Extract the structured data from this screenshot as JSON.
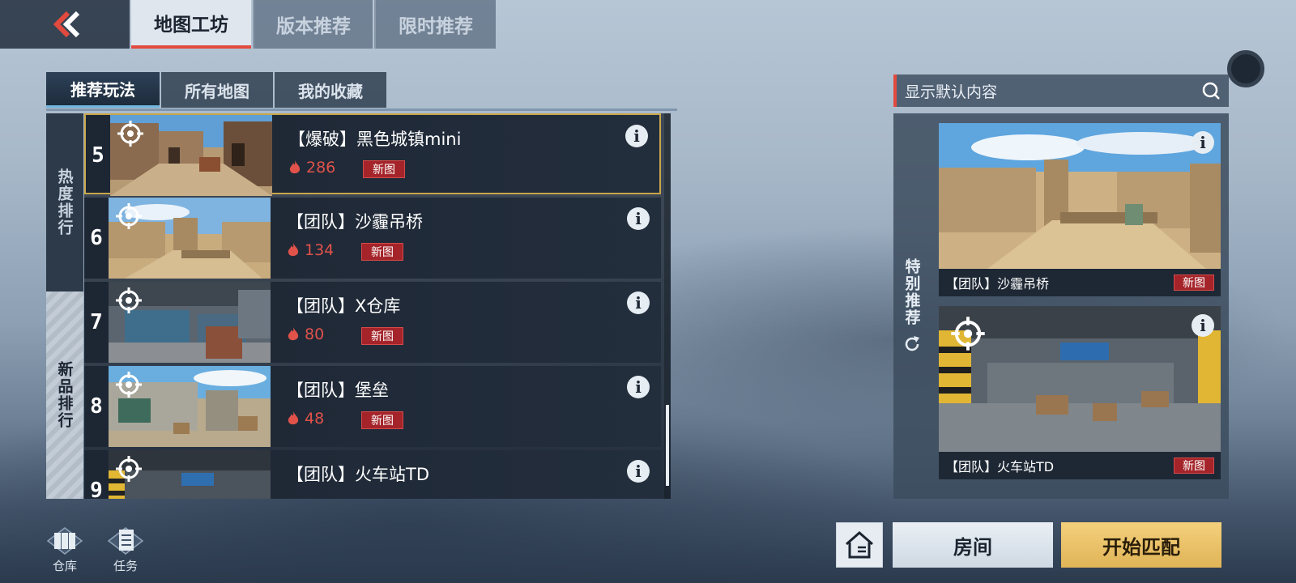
{
  "top_tabs": [
    {
      "label": "地图工坊",
      "active": true
    },
    {
      "label": "版本推荐",
      "active": false
    },
    {
      "label": "限时推荐",
      "active": false
    }
  ],
  "sub_tabs": [
    {
      "label": "推荐玩法",
      "active": true
    },
    {
      "label": "所有地图",
      "active": false
    },
    {
      "label": "我的收藏",
      "active": false
    }
  ],
  "rank_side": {
    "hot": "热度排行",
    "new": "新品排行"
  },
  "maps": [
    {
      "rank": "5",
      "title": "【爆破】黑色城镇mini",
      "heat": "286",
      "badge": "新图",
      "selected": true
    },
    {
      "rank": "6",
      "title": "【团队】沙霾吊桥",
      "heat": "134",
      "badge": "新图",
      "selected": false
    },
    {
      "rank": "7",
      "title": "【团队】X仓库",
      "heat": "80",
      "badge": "新图",
      "selected": false
    },
    {
      "rank": "8",
      "title": "【团队】堡垒",
      "heat": "48",
      "badge": "新图",
      "selected": false
    },
    {
      "rank": "9",
      "title": "【团队】火车站TD",
      "heat": "",
      "badge": "",
      "selected": false
    }
  ],
  "search": {
    "placeholder": "显示默认内容"
  },
  "featured": {
    "side_label": "特别推荐",
    "cards": [
      {
        "title": "【团队】沙霾吊桥",
        "badge": "新图"
      },
      {
        "title": "【团队】火车站TD",
        "badge": "新图"
      }
    ]
  },
  "bottom": {
    "warehouse": "仓库",
    "tasks": "任务",
    "room": "房间",
    "start": "开始匹配"
  },
  "colors": {
    "accent_red": "#e24a3f",
    "badge_red": "#a4242a",
    "gold": "#e0b457",
    "select_gold": "#c9a64a"
  },
  "icons": [
    "back-arrow-icon",
    "target-icon",
    "fire-icon",
    "info-icon",
    "search-icon",
    "refresh-icon",
    "warehouse-icon",
    "task-list-icon",
    "house-icon"
  ]
}
